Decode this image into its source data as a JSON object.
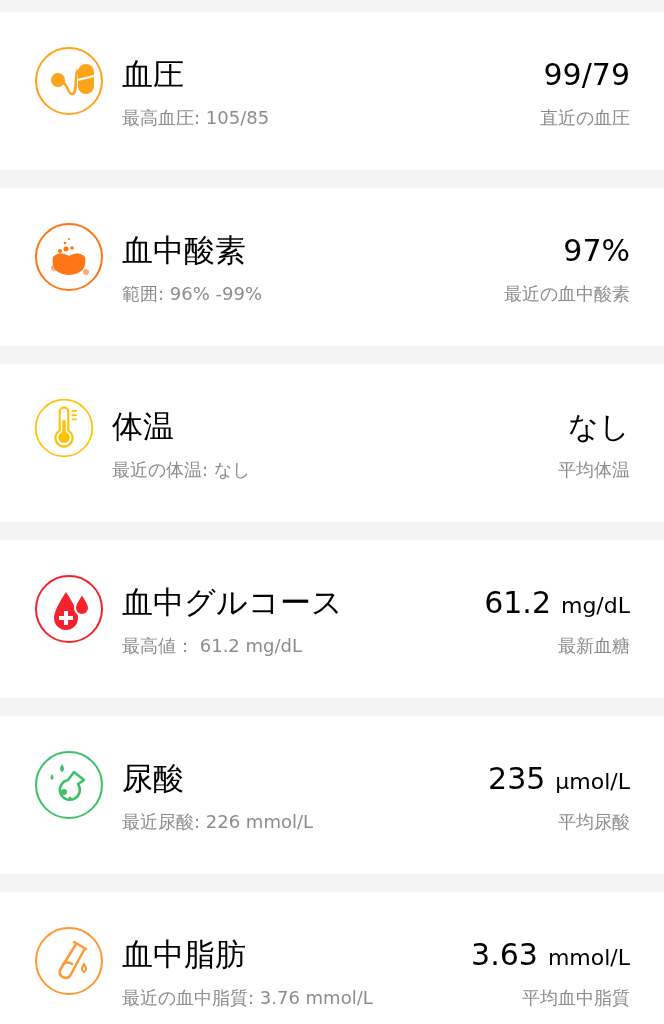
{
  "metrics": [
    {
      "kind": "pill",
      "color": "#ffa31a",
      "title": "血圧",
      "subtitle": "最高血圧: 105/85",
      "value": "99/79",
      "caption": "直近の血圧"
    },
    {
      "kind": "drops",
      "color": "#ff7518",
      "title": "血中酸素",
      "subtitle": "範囲: 96% -99%",
      "value": "97%",
      "caption": "最近の血中酸素"
    },
    {
      "kind": "thermometer",
      "color": "#ffc107",
      "title": "体温",
      "subtitle": "最近の体温: なし",
      "value": "なし",
      "caption": "平均体温"
    },
    {
      "kind": "blood",
      "color": "#f5222d",
      "title": "血中グルコース",
      "subtitle": "最高値： 61.2 mg/dL",
      "value": "61.2",
      "unit": "mg/dL",
      "caption": "最新血糖"
    },
    {
      "kind": "flask",
      "color": "#3cc266",
      "title": "尿酸",
      "subtitle": "最近尿酸: 226 mmol/L",
      "value": "235",
      "unit": "μmol/L",
      "caption": "平均尿酸"
    },
    {
      "kind": "tube",
      "color": "#ff9933",
      "title": "血中脂肪",
      "subtitle": "最近の血中脂質: 3.76 mmol/L",
      "value": "3.63",
      "unit": "mmol/L",
      "caption": "平均血中脂質"
    }
  ]
}
